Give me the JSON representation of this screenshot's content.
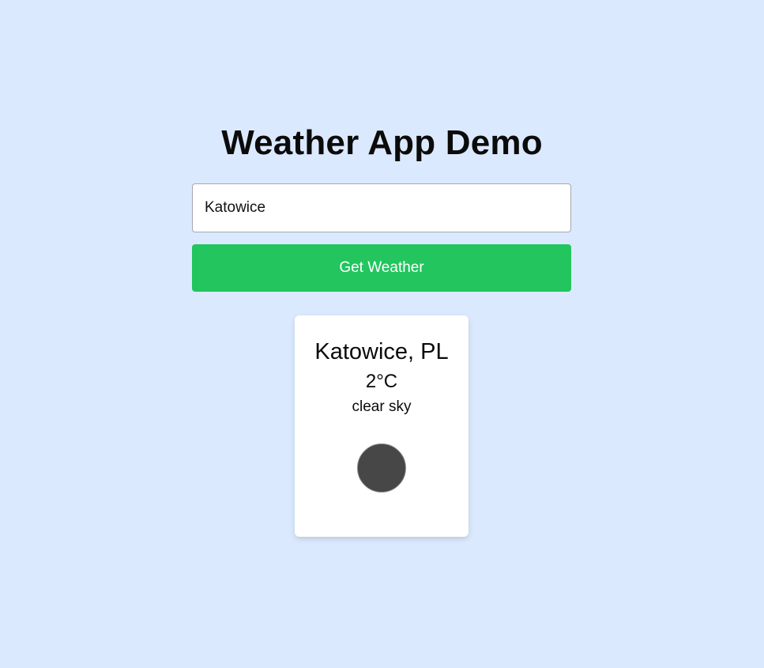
{
  "header": {
    "title": "Weather App Demo"
  },
  "search": {
    "value": "Katowice",
    "button_label": "Get Weather"
  },
  "weather_card": {
    "location": "Katowice, PL",
    "temperature": "2°C",
    "description": "clear sky",
    "icon": "weather-icon"
  },
  "colors": {
    "background": "#dbe9fe",
    "button": "#22c55e",
    "card": "#ffffff",
    "icon": "#474747"
  }
}
